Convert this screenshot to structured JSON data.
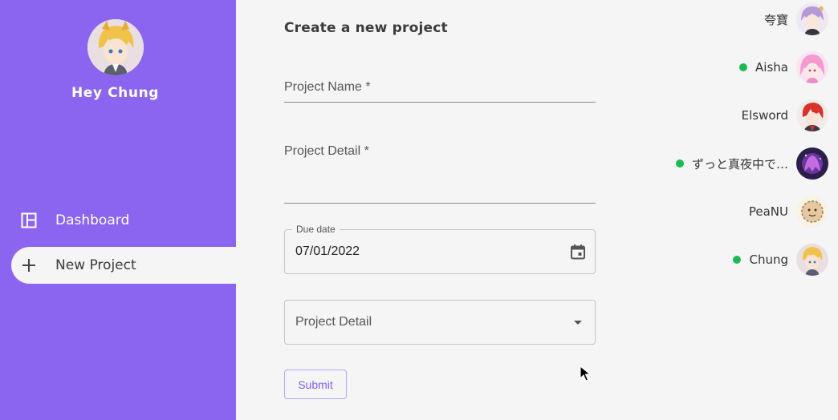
{
  "profile": {
    "greeting": "Hey Chung"
  },
  "nav": {
    "items": [
      {
        "label": "Dashboard",
        "icon": "dashboard-icon"
      },
      {
        "label": "New Project",
        "icon": "plus-icon",
        "active": true
      }
    ]
  },
  "form": {
    "title": "Create a new project",
    "project_name_label": "Project Name *",
    "project_detail_label": "Project Detail *",
    "due_date_label": "Due date",
    "due_date_value": "07/01/2022",
    "select_placeholder": "Project Detail",
    "submit_label": "Submit"
  },
  "users": [
    {
      "name": "夸寶",
      "online": false
    },
    {
      "name": "Aisha",
      "online": true
    },
    {
      "name": "Elsword",
      "online": false
    },
    {
      "name": "ずっと真夜中で…",
      "online": true
    },
    {
      "name": "PeaNU",
      "online": false
    },
    {
      "name": "Chung",
      "online": true
    }
  ],
  "colors": {
    "sidebar": "#8b65f0",
    "background": "#f5f5f5",
    "online": "#1db954",
    "accent": "#7e5cf0"
  }
}
